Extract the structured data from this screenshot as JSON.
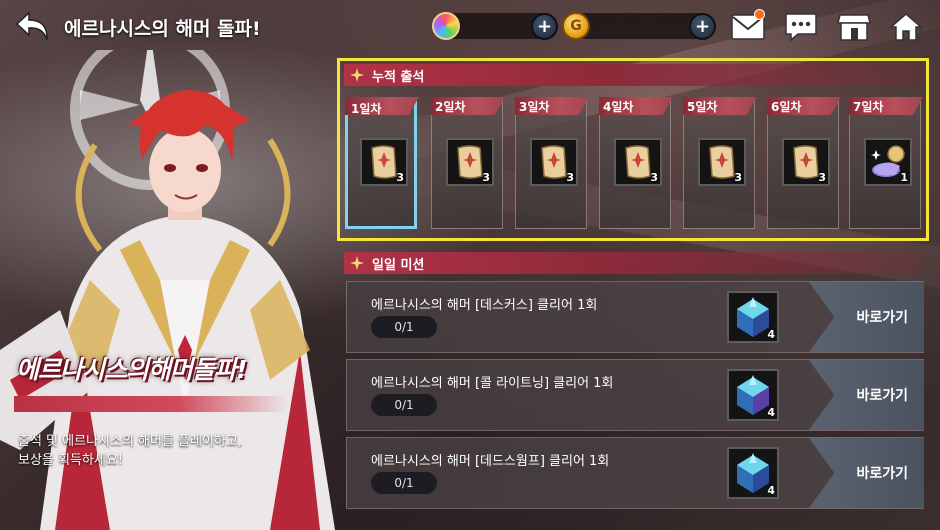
{
  "header": {
    "title": "에르나시스의 해머 돌파!",
    "currencies": [
      {
        "name": "gem",
        "icon": "rainbow-gem-icon",
        "value": ""
      },
      {
        "name": "gold",
        "icon": "gold-coin-icon",
        "symbol": "G",
        "value": ""
      }
    ],
    "plus_symbol": "+",
    "icons": [
      "mail-icon",
      "chat-icon",
      "shop-icon",
      "home-icon"
    ],
    "mail_has_notification": true
  },
  "hero": {
    "name": "에르나시스의해머돌파!",
    "description_line1": "출석 및 에르나시스의 해머를 플레이하고,",
    "description_line2": "보상을 획득하세요!"
  },
  "attendance": {
    "section_label": "누적 출석",
    "selected_index": 0,
    "days": [
      {
        "label": "1일차",
        "item": "scroll-icon",
        "count": "3"
      },
      {
        "label": "2일차",
        "item": "scroll-icon",
        "count": "3"
      },
      {
        "label": "3일차",
        "item": "scroll-icon",
        "count": "3"
      },
      {
        "label": "4일차",
        "item": "scroll-icon",
        "count": "3"
      },
      {
        "label": "5일차",
        "item": "scroll-icon",
        "count": "3"
      },
      {
        "label": "6일차",
        "item": "scroll-icon",
        "count": "3"
      },
      {
        "label": "7일차",
        "item": "magic-lamp-icon",
        "count": "1"
      }
    ]
  },
  "daily": {
    "section_label": "일일 미션",
    "go_label": "바로가기",
    "missions": [
      {
        "text": "에르나시스의 해머 [데스커스] 클리어 1회",
        "progress": "0/1",
        "reward_icon": "crystal-cube-icon",
        "reward_count": "4"
      },
      {
        "text": "에르나시스의 해머 [콜 라이트닝] 클리어 1회",
        "progress": "0/1",
        "reward_icon": "crystal-cube-icon",
        "reward_count": "4"
      },
      {
        "text": "에르나시스의 해머 [데드스웜프] 클리어 1회",
        "progress": "0/1",
        "reward_icon": "crystal-cube-icon",
        "reward_count": "4"
      }
    ]
  },
  "colors": {
    "accent_red": "#b23246",
    "selected_outline": "#7fd3ef",
    "highlight_frame": "#f6e43a",
    "go_button": "#5b6270"
  }
}
